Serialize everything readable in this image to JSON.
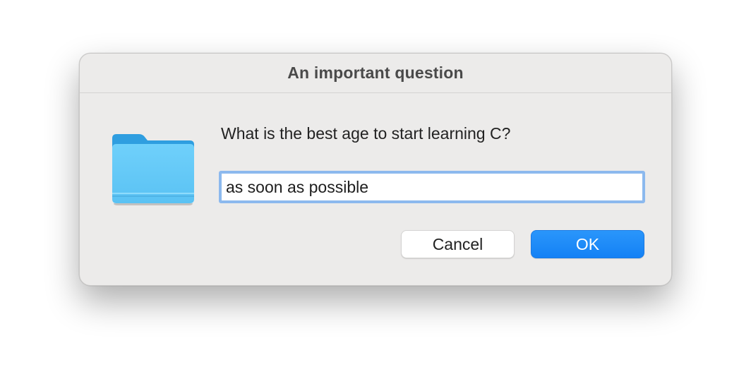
{
  "dialog": {
    "title": "An important question",
    "icon": "folder-icon",
    "prompt": "What is the best age to start learning C?",
    "answer_value": "as soon as possible",
    "cancel_label": "Cancel",
    "ok_label": "OK"
  },
  "colors": {
    "dialog_background": "#ecebea",
    "accent": "#1481f5",
    "field_focus_ring": "#8cb9ee",
    "folder_blue": "#63c5f5"
  }
}
